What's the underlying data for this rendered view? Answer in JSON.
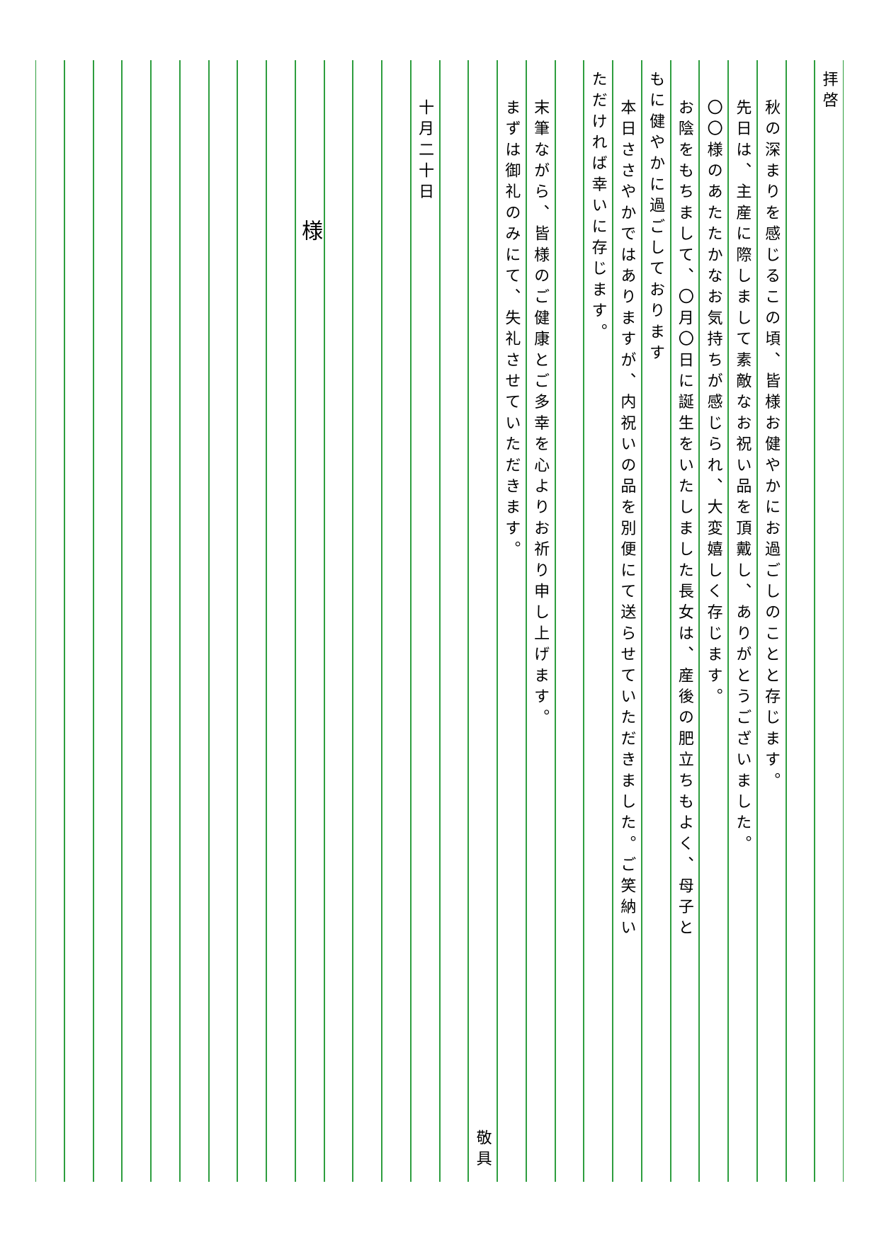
{
  "letter": {
    "columns": [
      {
        "text": "拝啓",
        "position": "top"
      },
      {
        "text": "",
        "position": "top"
      },
      {
        "text": "秋の深まりを感じるこの頃、皆様お健やかにお過ごしのことと存じます。",
        "position": "indent"
      },
      {
        "text": "先日は、主産に際しまして素敵なお祝い品を頂戴し、ありがとうございました。",
        "position": "indent"
      },
      {
        "text": "〇〇様のあたたかなお気持ちが感じられ、大変嬉しく存じます。",
        "position": "indent"
      },
      {
        "text": "お陰をもちまして、〇月〇日に誕生をいたしました長女は、産後の肥立ちもよく、母子と",
        "position": "indent"
      },
      {
        "text": "もに健やかに過ごしております",
        "position": "top"
      },
      {
        "text": "本日ささやかではありますが、内祝いの品を別便にて送らせていただきました。ご笑納い",
        "position": "indent"
      },
      {
        "text": "ただければ幸いに存じます。",
        "position": "top"
      },
      {
        "text": "",
        "position": "top"
      },
      {
        "text": "末筆ながら、皆様のご健康とご多幸を心よりお祈り申し上げます。",
        "position": "indent"
      },
      {
        "text": "まずは御礼のみにて、失礼させていただきます。",
        "position": "indent"
      },
      {
        "text": "敬具",
        "position": "bottom"
      },
      {
        "text": "",
        "position": "top"
      },
      {
        "text": "十月二十日",
        "position": "indent"
      },
      {
        "text": "",
        "position": "top"
      },
      {
        "text": "",
        "position": "top"
      },
      {
        "text": "",
        "position": "top"
      },
      {
        "text": "様",
        "position": "addressee"
      },
      {
        "text": "",
        "position": "top"
      },
      {
        "text": "",
        "position": "top"
      },
      {
        "text": "",
        "position": "top"
      },
      {
        "text": "",
        "position": "top"
      },
      {
        "text": "",
        "position": "top"
      },
      {
        "text": "",
        "position": "top"
      },
      {
        "text": "",
        "position": "top"
      },
      {
        "text": "",
        "position": "top"
      },
      {
        "text": "",
        "position": "top"
      }
    ]
  }
}
